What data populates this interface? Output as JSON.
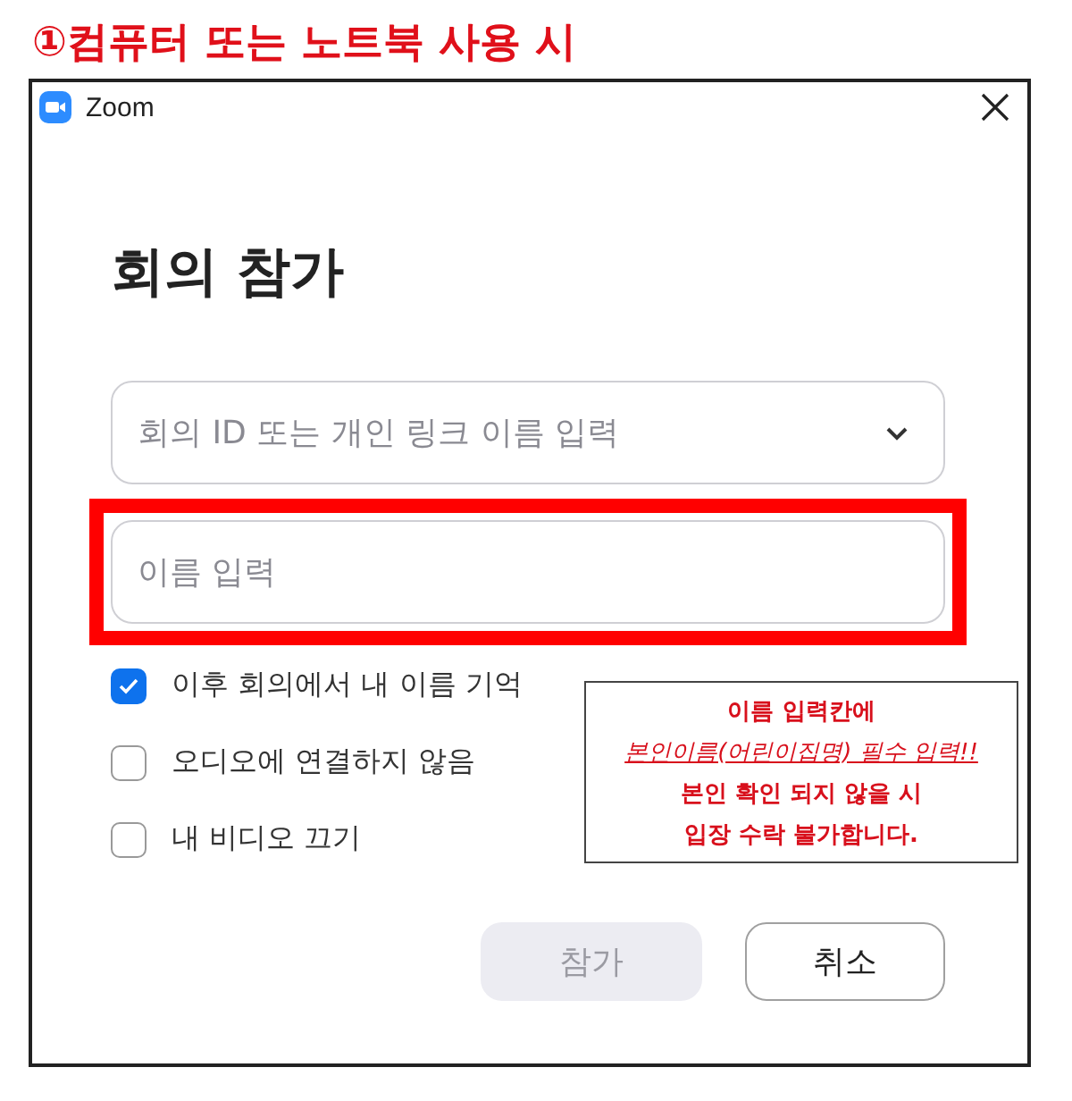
{
  "heading": "①컴퓨터 또는 노트북 사용 시",
  "window": {
    "title": "Zoom"
  },
  "dialog": {
    "title": "회의 참가",
    "meeting_field": {
      "placeholder": "회의 ID 또는 개인 링크 이름 입력"
    },
    "name_field": {
      "placeholder": "이름 입력",
      "highlighted": true
    },
    "options": [
      {
        "label": "이후 회의에서 내 이름 기억",
        "checked": true
      },
      {
        "label": "오디오에 연결하지 않음",
        "checked": false
      },
      {
        "label": "내 비디오 끄기",
        "checked": false
      }
    ],
    "buttons": [
      {
        "label": "참가",
        "disabled": true
      },
      {
        "label": "취소",
        "disabled": false
      }
    ]
  },
  "note": {
    "lines": [
      {
        "text": "이름 입력칸에",
        "kind": "plain"
      },
      {
        "text": "본인이름(어린이집명) 필수 입력!!",
        "kind": "emphasis"
      },
      {
        "text": "본인 확인 되지 않을 시",
        "kind": "plain"
      },
      {
        "text": "입장 수락 불가합니다.",
        "kind": "plain"
      }
    ]
  }
}
